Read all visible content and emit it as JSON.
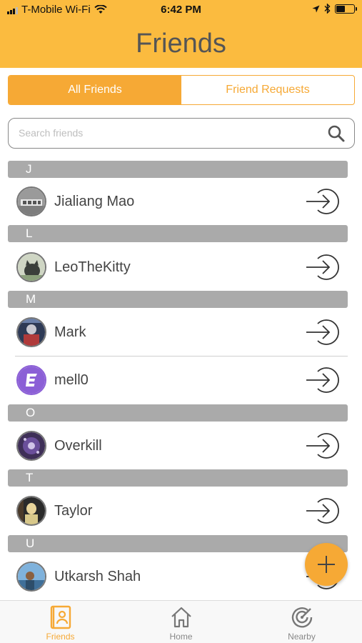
{
  "status_bar": {
    "carrier": "T-Mobile Wi-Fi",
    "time": "6:42 PM"
  },
  "header": {
    "title": "Friends"
  },
  "segments": {
    "all_friends": "All Friends",
    "friend_requests": "Friend Requests"
  },
  "search": {
    "placeholder": "Search friends",
    "value": ""
  },
  "sections": [
    {
      "letter": "J",
      "friends": [
        {
          "name": "Jialiang Mao"
        }
      ]
    },
    {
      "letter": "L",
      "friends": [
        {
          "name": "LeoTheKitty"
        }
      ]
    },
    {
      "letter": "M",
      "friends": [
        {
          "name": "Mark"
        },
        {
          "name": "mell0"
        }
      ]
    },
    {
      "letter": "O",
      "friends": [
        {
          "name": "Overkill"
        }
      ]
    },
    {
      "letter": "T",
      "friends": [
        {
          "name": "Taylor"
        }
      ]
    },
    {
      "letter": "U",
      "friends": [
        {
          "name": "Utkarsh Shah"
        }
      ]
    }
  ],
  "tabbar": {
    "friends": "Friends",
    "home": "Home",
    "nearby": "Nearby"
  },
  "colors": {
    "header": "#fbbb3f",
    "accent": "#f6a935",
    "section": "#aaaaaa"
  }
}
